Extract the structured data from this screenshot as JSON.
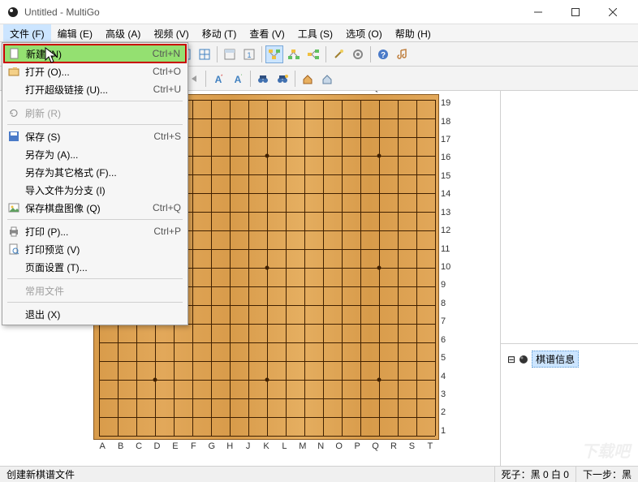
{
  "title": "Untitled - MultiGo",
  "menubar": [
    {
      "label": "文件 (F)"
    },
    {
      "label": "编辑 (E)"
    },
    {
      "label": "高级 (A)"
    },
    {
      "label": "视频 (V)"
    },
    {
      "label": "移动 (T)"
    },
    {
      "label": "查看 (V)"
    },
    {
      "label": "工具 (S)"
    },
    {
      "label": "选项 (O)"
    },
    {
      "label": "帮助 (H)"
    }
  ],
  "file_menu": [
    {
      "icon": "new-doc",
      "label": "新建 (N)",
      "shortcut": "Ctrl+N",
      "highlighted": true
    },
    {
      "icon": "open",
      "label": "打开 (O)...",
      "shortcut": "Ctrl+O"
    },
    {
      "icon": "",
      "label": "打开超级链接 (U)...",
      "shortcut": "Ctrl+U"
    },
    {
      "sep": true
    },
    {
      "icon": "refresh",
      "label": "刷新 (R)",
      "disabled": true
    },
    {
      "sep": true
    },
    {
      "icon": "save",
      "label": "保存 (S)",
      "shortcut": "Ctrl+S"
    },
    {
      "icon": "",
      "label": "另存为 (A)..."
    },
    {
      "icon": "",
      "label": "另存为其它格式 (F)..."
    },
    {
      "icon": "",
      "label": "导入文件为分支 (I)"
    },
    {
      "icon": "pic",
      "label": "保存棋盘图像 (Q)",
      "shortcut": "Ctrl+Q"
    },
    {
      "sep": true
    },
    {
      "icon": "print",
      "label": "打印 (P)...",
      "shortcut": "Ctrl+P"
    },
    {
      "icon": "preview",
      "label": "打印预览 (V)"
    },
    {
      "icon": "",
      "label": "页面设置 (T)..."
    },
    {
      "sep": true
    },
    {
      "icon": "",
      "label": "常用文件",
      "disabled": true
    },
    {
      "sep": true
    },
    {
      "icon": "",
      "label": "退出 (X)"
    }
  ],
  "board": {
    "size": 19,
    "letters": [
      "A",
      "B",
      "C",
      "D",
      "E",
      "F",
      "G",
      "H",
      "J",
      "K",
      "L",
      "M",
      "N",
      "O",
      "P",
      "Q",
      "R",
      "S",
      "T"
    ],
    "numbers_right": [
      "19",
      "18",
      "17",
      "16",
      "15",
      "14",
      "13",
      "12",
      "11",
      "10",
      "9",
      "8",
      "7",
      "6",
      "5",
      "4",
      "3",
      "2",
      "1"
    ],
    "stars": [
      [
        3,
        3
      ],
      [
        3,
        9
      ],
      [
        3,
        15
      ],
      [
        9,
        3
      ],
      [
        9,
        9
      ],
      [
        9,
        15
      ],
      [
        15,
        3
      ],
      [
        15,
        9
      ],
      [
        15,
        15
      ]
    ]
  },
  "tree": {
    "root_label": "棋谱信息"
  },
  "status": {
    "left": "创建新棋谱文件",
    "captures": "死子：黑 0 白 0",
    "next": "下一步：黑"
  },
  "watermark": "下载吧"
}
